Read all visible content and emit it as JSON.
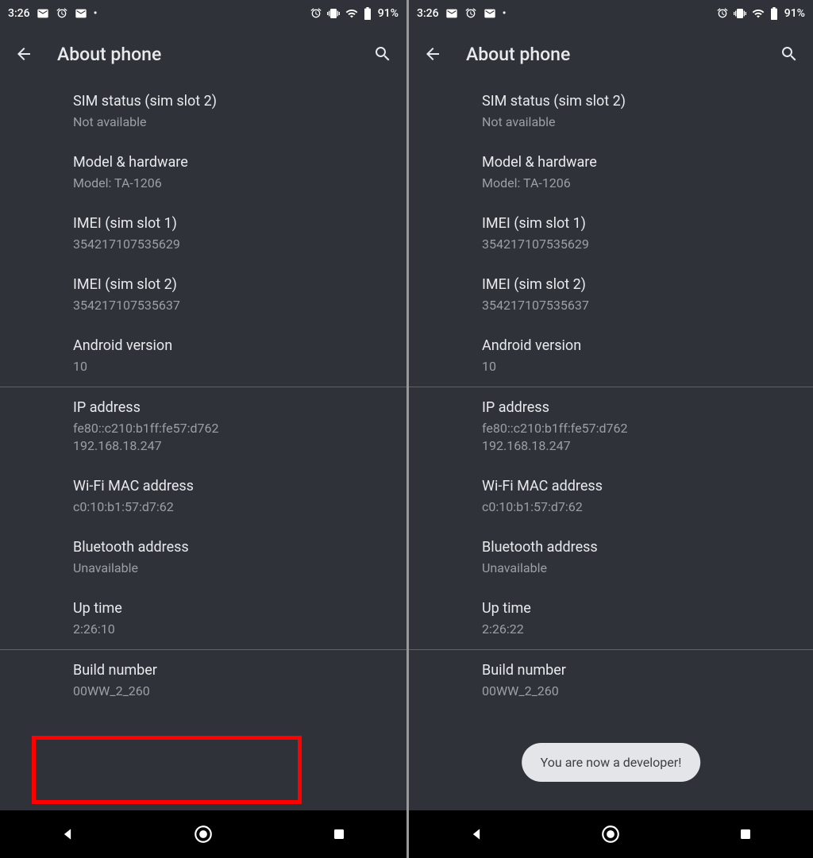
{
  "status": {
    "time": "3:26",
    "battery": "91%"
  },
  "header": {
    "title": "About phone"
  },
  "items": {
    "sim2": {
      "label": "SIM status (sim slot 2)",
      "value": "Not available"
    },
    "model": {
      "label": "Model & hardware",
      "value": "Model: TA-1206"
    },
    "imei1": {
      "label": "IMEI (sim slot 1)",
      "value": "354217107535629"
    },
    "imei2": {
      "label": "IMEI (sim slot 2)",
      "value": "354217107535637"
    },
    "android": {
      "label": "Android version",
      "value": "10"
    },
    "ip": {
      "label": "IP address",
      "line1": "fe80::c210:b1ff:fe57:d762",
      "line2": "192.168.18.247"
    },
    "wifi": {
      "label": "Wi-Fi MAC address",
      "value": "c0:10:b1:57:d7:62"
    },
    "bt": {
      "label": "Bluetooth address",
      "value": "Unavailable"
    },
    "uptime_left": {
      "label": "Up time",
      "value": "2:26:10"
    },
    "uptime_right": {
      "label": "Up time",
      "value": "2:26:22"
    },
    "build": {
      "label": "Build number",
      "value": "00WW_2_260"
    }
  },
  "toast": "You are now a developer!"
}
